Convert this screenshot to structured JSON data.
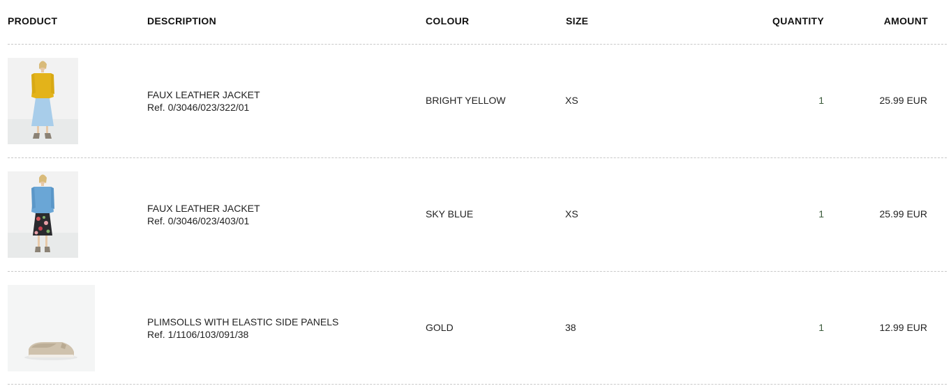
{
  "headers": {
    "product": "PRODUCT",
    "description": "DESCRIPTION",
    "colour": "COLOUR",
    "size": "SIZE",
    "quantity": "QUANTITY",
    "amount": "AMOUNT"
  },
  "items": [
    {
      "image": "woman-yellow-jacket-photo",
      "name": "FAUX LEATHER JACKET",
      "ref": "Ref. 0/3046/023/322/01",
      "colour": "BRIGHT YELLOW",
      "size": "XS",
      "quantity": "1",
      "amount": "25.99 EUR"
    },
    {
      "image": "woman-blue-jacket-photo",
      "name": "FAUX LEATHER JACKET",
      "ref": "Ref. 0/3046/023/403/01",
      "colour": "SKY BLUE",
      "size": "XS",
      "quantity": "1",
      "amount": "25.99 EUR"
    },
    {
      "image": "plimsoll-shoe-photo",
      "name": "PLIMSOLLS WITH ELASTIC SIDE PANELS",
      "ref": "Ref. 1/1106/103/091/38",
      "colour": "GOLD",
      "size": "38",
      "quantity": "1",
      "amount": "12.99 EUR"
    }
  ],
  "colors": {
    "divider": "#c8c8c8",
    "text": "#222222",
    "quantity_text": "#3a5a3a"
  }
}
